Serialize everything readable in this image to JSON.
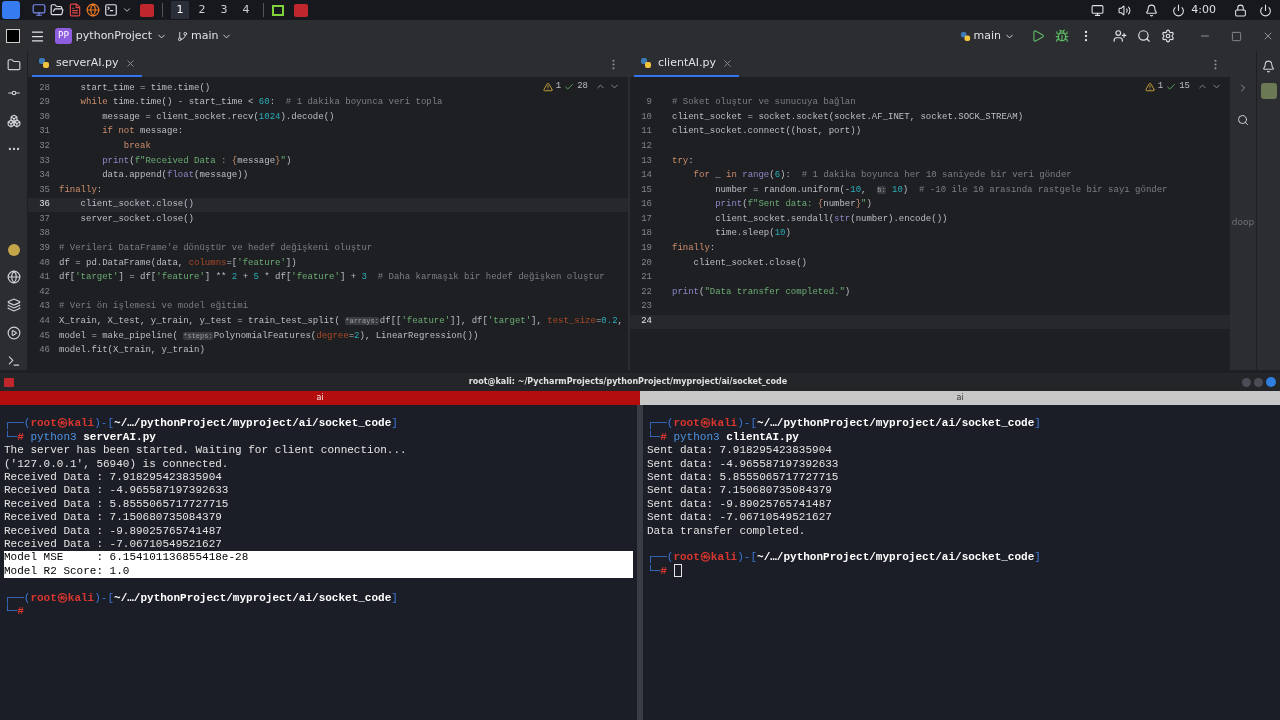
{
  "taskbar": {
    "workspaces": [
      {
        "label": "1",
        "selected": true
      },
      {
        "label": "2",
        "selected": false
      },
      {
        "label": "3",
        "selected": false
      },
      {
        "label": "4",
        "selected": false
      }
    ],
    "clock": "4:00"
  },
  "ide": {
    "project_badge": "PP",
    "project": "pythonProject",
    "branch": "main",
    "run_config": "main"
  },
  "editors": [
    {
      "tab": "serverAI.py",
      "warnings": "1",
      "checks": "28",
      "lines": [
        {
          "n": "28",
          "selected": false,
          "parts": [
            {
              "t": "    start_time = time.time()"
            }
          ]
        },
        {
          "n": "29",
          "selected": false,
          "parts": [
            {
              "kind": "kw",
              "t": "    while "
            },
            {
              "t": "time.time() - start_time < "
            },
            {
              "kind": "num",
              "t": "60"
            },
            {
              "t": ":  "
            },
            {
              "kind": "cmt",
              "t": "# 1 dakika boyunca veri topla"
            }
          ]
        },
        {
          "n": "30",
          "selected": false,
          "parts": [
            {
              "t": "        message = client_socket.recv("
            },
            {
              "kind": "num",
              "t": "1024"
            },
            {
              "t": ").decode()"
            }
          ]
        },
        {
          "n": "31",
          "selected": false,
          "parts": [
            {
              "kind": "kw",
              "t": "        if not "
            },
            {
              "t": "message:"
            }
          ]
        },
        {
          "n": "32",
          "selected": false,
          "parts": [
            {
              "kind": "kw",
              "t": "            break"
            }
          ]
        },
        {
          "n": "33",
          "selected": false,
          "parts": [
            {
              "kind": "builtin",
              "t": "        print"
            },
            {
              "t": "("
            },
            {
              "kind": "str",
              "t": "f\"Received Data : "
            },
            {
              "kind": "fmt",
              "t": "{"
            },
            {
              "t": "message"
            },
            {
              "kind": "fmt",
              "t": "}"
            },
            {
              "kind": "str",
              "t": "\""
            },
            {
              "t": ")"
            }
          ]
        },
        {
          "n": "34",
          "selected": false,
          "parts": [
            {
              "t": "        data.append("
            },
            {
              "kind": "builtin",
              "t": "float"
            },
            {
              "t": "(message))"
            }
          ]
        },
        {
          "n": "35",
          "selected": false,
          "parts": [
            {
              "kind": "kw",
              "t": "finally"
            },
            {
              "t": ":"
            }
          ]
        },
        {
          "n": "36",
          "selected": true,
          "parts": [
            {
              "t": "    client_socket.close()"
            }
          ]
        },
        {
          "n": "37",
          "selected": false,
          "parts": [
            {
              "t": "    server_socket.close()"
            }
          ]
        },
        {
          "n": "38",
          "selected": false
        },
        {
          "n": "39",
          "selected": false,
          "parts": [
            {
              "kind": "cmt",
              "t": "# Verileri DataFrame'e dönüştür ve hedef değişkeni oluştur"
            }
          ]
        },
        {
          "n": "40",
          "selected": false,
          "parts": [
            {
              "t": "df = pd.DataFrame(data, "
            },
            {
              "kind": "param",
              "t": "columns"
            },
            {
              "t": "=["
            },
            {
              "kind": "str",
              "t": "'feature'"
            },
            {
              "t": "])"
            }
          ]
        },
        {
          "n": "41",
          "selected": false,
          "parts": [
            {
              "t": "df["
            },
            {
              "kind": "str",
              "t": "'target'"
            },
            {
              "t": "] = df["
            },
            {
              "kind": "str",
              "t": "'feature'"
            },
            {
              "t": "] ** "
            },
            {
              "kind": "num",
              "t": "2"
            },
            {
              "t": " + "
            },
            {
              "kind": "num",
              "t": "5"
            },
            {
              "t": " * df["
            },
            {
              "kind": "str",
              "t": "'feature'"
            },
            {
              "t": "] + "
            },
            {
              "kind": "num",
              "t": "3"
            },
            {
              "kind": "cmt",
              "t": "  # Daha karmaşık bir hedef değişken oluştur"
            }
          ]
        },
        {
          "n": "42",
          "selected": false
        },
        {
          "n": "43",
          "selected": false,
          "parts": [
            {
              "kind": "cmt",
              "t": "# Veri ön işlemesi ve model eğitimi"
            }
          ]
        },
        {
          "n": "44",
          "selected": false,
          "parts": [
            {
              "t": "X_train, X_test, y_train, y_test = train_test_split( "
            },
            {
              "kind": "hint",
              "t": "*arrays:"
            },
            {
              "t": "df[["
            },
            {
              "kind": "str",
              "t": "'feature'"
            },
            {
              "t": "]], df["
            },
            {
              "kind": "str",
              "t": "'target'"
            },
            {
              "t": "], "
            },
            {
              "kind": "param",
              "t": "test_size"
            },
            {
              "t": "="
            },
            {
              "kind": "num",
              "t": "0.2"
            },
            {
              "t": ","
            }
          ]
        },
        {
          "n": "45",
          "selected": false,
          "parts": [
            {
              "t": "model = make_pipeline( "
            },
            {
              "kind": "hint",
              "t": "*steps:"
            },
            {
              "t": "PolynomialFeatures("
            },
            {
              "kind": "param",
              "t": "degree"
            },
            {
              "t": "="
            },
            {
              "kind": "num",
              "t": "2"
            },
            {
              "t": "), LinearRegression())"
            }
          ]
        },
        {
          "n": "46",
          "selected": false,
          "parts": [
            {
              "t": "model.fit(X_train, y_train)"
            }
          ]
        }
      ]
    },
    {
      "tab": "clientAI.py",
      "warnings": "1",
      "checks": "15",
      "lines": [
        {
          "n": "9",
          "selected": false,
          "parts": [
            {
              "kind": "cmt",
              "t": "# Soket oluştur ve sunucuya bağlan"
            }
          ]
        },
        {
          "n": "10",
          "selected": false,
          "parts": [
            {
              "t": "client_socket = socket.socket(socket.AF_INET, socket.SOCK_STREAM)"
            }
          ]
        },
        {
          "n": "11",
          "selected": false,
          "parts": [
            {
              "t": "client_socket.connect((host, port))"
            }
          ]
        },
        {
          "n": "12",
          "selected": false
        },
        {
          "n": "13",
          "selected": false,
          "parts": [
            {
              "kind": "kw",
              "t": "try"
            },
            {
              "t": ":"
            }
          ]
        },
        {
          "n": "14",
          "selected": false,
          "parts": [
            {
              "kind": "kw",
              "t": "    for "
            },
            {
              "t": "_ "
            },
            {
              "kind": "kw",
              "t": "in "
            },
            {
              "kind": "builtin",
              "t": "range"
            },
            {
              "t": "("
            },
            {
              "kind": "num",
              "t": "6"
            },
            {
              "t": "):  "
            },
            {
              "kind": "cmt",
              "t": "# 1 dakika boyunca her 10 saniyede bir veri gönder"
            }
          ]
        },
        {
          "n": "15",
          "selected": false,
          "parts": [
            {
              "t": "        number = random.uniform(-"
            },
            {
              "kind": "num",
              "t": "10"
            },
            {
              "t": ",  "
            },
            {
              "kind": "hint",
              "t": "b:"
            },
            {
              "kind": "num",
              "t": " 10"
            },
            {
              "t": ")  "
            },
            {
              "kind": "cmt",
              "t": "# -10 ile 10 arasında rastgele bir sayı gönder"
            }
          ]
        },
        {
          "n": "16",
          "selected": false,
          "parts": [
            {
              "kind": "builtin",
              "t": "        print"
            },
            {
              "t": "("
            },
            {
              "kind": "str",
              "t": "f\"Sent data: "
            },
            {
              "kind": "fmt",
              "t": "{"
            },
            {
              "t": "number"
            },
            {
              "kind": "fmt",
              "t": "}"
            },
            {
              "kind": "str",
              "t": "\""
            },
            {
              "t": ")"
            }
          ]
        },
        {
          "n": "17",
          "selected": false,
          "parts": [
            {
              "t": "        client_socket.sendall("
            },
            {
              "kind": "builtin",
              "t": "str"
            },
            {
              "t": "(number).encode())"
            }
          ]
        },
        {
          "n": "18",
          "selected": false,
          "parts": [
            {
              "t": "        time.sleep("
            },
            {
              "kind": "num",
              "t": "10"
            },
            {
              "t": ")"
            }
          ]
        },
        {
          "n": "19",
          "selected": false,
          "parts": [
            {
              "kind": "kw",
              "t": "finally"
            },
            {
              "t": ":"
            }
          ]
        },
        {
          "n": "20",
          "selected": false,
          "parts": [
            {
              "t": "    client_socket.close()"
            }
          ]
        },
        {
          "n": "21",
          "selected": false
        },
        {
          "n": "22",
          "selected": false,
          "parts": [
            {
              "kind": "builtin",
              "t": "print"
            },
            {
              "t": "("
            },
            {
              "kind": "str",
              "t": "\"Data transfer completed.\""
            },
            {
              "t": ")"
            }
          ]
        },
        {
          "n": "23",
          "selected": false
        },
        {
          "n": "24",
          "selected": true
        }
      ]
    }
  ],
  "side_label": "doop",
  "terminal": {
    "title": "root@kali: ~/PycharmProjects/pythonProject/myproject/ai/socket_code",
    "panes": [
      {
        "tab": "ai",
        "selected": true,
        "lines": [
          {
            "highlighted": false,
            "cursor": false,
            "parts": [
              {
                "kind": "frame",
                "t": "┌──("
              },
              {
                "kind": "user",
                "t": "root㉿kali"
              },
              {
                "kind": "frame",
                "t": ")-["
              },
              {
                "kind": "path",
                "t": "~/…/pythonProject/myproject/ai/socket_code"
              },
              {
                "kind": "frame",
                "t": "]"
              }
            ]
          },
          {
            "highlighted": false,
            "cursor": false,
            "parts": [
              {
                "kind": "frame",
                "t": "└─"
              },
              {
                "kind": "user",
                "t": "#"
              },
              {
                "kind": "cmd",
                "t": " python3"
              },
              {
                "kind": "path",
                "t": " serverAI.py"
              }
            ]
          },
          {
            "highlighted": false,
            "cursor": false,
            "parts": [
              {
                "t": "The server has been started. Waiting for client connection..."
              }
            ]
          },
          {
            "highlighted": false,
            "cursor": false,
            "parts": [
              {
                "t": "('127.0.0.1', 56940) is connected."
              }
            ]
          },
          {
            "highlighted": false,
            "cursor": false,
            "parts": [
              {
                "t": "Received Data : 7.918295423835904"
              }
            ]
          },
          {
            "highlighted": false,
            "cursor": false,
            "parts": [
              {
                "t": "Received Data : -4.965587197392633"
              }
            ]
          },
          {
            "highlighted": false,
            "cursor": false,
            "parts": [
              {
                "t": "Received Data : 5.8555065717727715"
              }
            ]
          },
          {
            "highlighted": false,
            "cursor": false,
            "parts": [
              {
                "t": "Received Data : 7.150680735084379"
              }
            ]
          },
          {
            "highlighted": false,
            "cursor": false,
            "parts": [
              {
                "t": "Received Data : -9.89025765741487"
              }
            ]
          },
          {
            "highlighted": false,
            "cursor": false,
            "parts": [
              {
                "t": "Received Data : -7.06710549521627"
              }
            ]
          },
          {
            "highlighted": true,
            "cursor": false,
            "parts": [
              {
                "t": "Model MSE     : 6.154101136855418e-28"
              }
            ]
          },
          {
            "highlighted": true,
            "cursor": false,
            "parts": [
              {
                "t": "Model R2 Score: 1.0"
              }
            ]
          },
          {
            "highlighted": false,
            "cursor": false
          },
          {
            "highlighted": false,
            "cursor": false,
            "parts": [
              {
                "kind": "frame",
                "t": "┌──("
              },
              {
                "kind": "user",
                "t": "root㉿kali"
              },
              {
                "kind": "frame",
                "t": ")-["
              },
              {
                "kind": "path",
                "t": "~/…/pythonProject/myproject/ai/socket_code"
              },
              {
                "kind": "frame",
                "t": "]"
              }
            ]
          },
          {
            "highlighted": false,
            "cursor": false,
            "parts": [
              {
                "kind": "frame",
                "t": "└─"
              },
              {
                "kind": "user",
                "t": "#"
              }
            ]
          }
        ]
      },
      {
        "tab": "ai",
        "selected": false,
        "lines": [
          {
            "highlighted": false,
            "cursor": false,
            "parts": [
              {
                "kind": "frame",
                "t": "┌──("
              },
              {
                "kind": "user",
                "t": "root㉿kali"
              },
              {
                "kind": "frame",
                "t": ")-["
              },
              {
                "kind": "path",
                "t": "~/…/pythonProject/myproject/ai/socket_code"
              },
              {
                "kind": "frame",
                "t": "]"
              }
            ]
          },
          {
            "highlighted": false,
            "cursor": false,
            "parts": [
              {
                "kind": "frame",
                "t": "└─"
              },
              {
                "kind": "user",
                "t": "#"
              },
              {
                "kind": "cmd",
                "t": " python3"
              },
              {
                "kind": "path",
                "t": " clientAI.py"
              }
            ]
          },
          {
            "highlighted": false,
            "cursor": false,
            "parts": [
              {
                "t": "Sent data: 7.918295423835904"
              }
            ]
          },
          {
            "highlighted": false,
            "cursor": false,
            "parts": [
              {
                "t": "Sent data: -4.965587197392633"
              }
            ]
          },
          {
            "highlighted": false,
            "cursor": false,
            "parts": [
              {
                "t": "Sent data: 5.8555065717727715"
              }
            ]
          },
          {
            "highlighted": false,
            "cursor": false,
            "parts": [
              {
                "t": "Sent data: 7.150680735084379"
              }
            ]
          },
          {
            "highlighted": false,
            "cursor": false,
            "parts": [
              {
                "t": "Sent data: -9.89025765741487"
              }
            ]
          },
          {
            "highlighted": false,
            "cursor": false,
            "parts": [
              {
                "t": "Sent data: -7.06710549521627"
              }
            ]
          },
          {
            "highlighted": false,
            "cursor": false,
            "parts": [
              {
                "t": "Data transfer completed."
              }
            ]
          },
          {
            "highlighted": false,
            "cursor": false
          },
          {
            "highlighted": false,
            "cursor": false,
            "parts": [
              {
                "kind": "frame",
                "t": "┌──("
              },
              {
                "kind": "user",
                "t": "root㉿kali"
              },
              {
                "kind": "frame",
                "t": ")-["
              },
              {
                "kind": "path",
                "t": "~/…/pythonProject/myproject/ai/socket_code"
              },
              {
                "kind": "frame",
                "t": "]"
              }
            ]
          },
          {
            "highlighted": false,
            "cursor": true,
            "parts": [
              {
                "kind": "frame",
                "t": "└─"
              },
              {
                "kind": "user",
                "t": "#"
              }
            ]
          }
        ]
      }
    ]
  }
}
